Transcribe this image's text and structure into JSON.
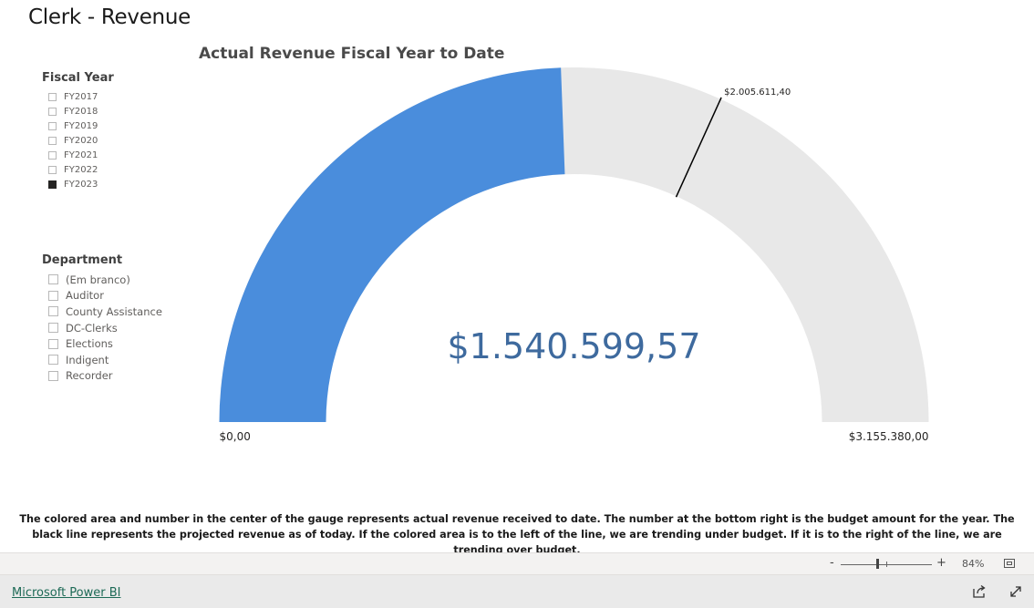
{
  "page": {
    "title": "Clerk - Revenue"
  },
  "slicers": {
    "fiscal_year": {
      "title": "Fiscal Year",
      "items": [
        {
          "label": "FY2017",
          "checked": false
        },
        {
          "label": "FY2018",
          "checked": false
        },
        {
          "label": "FY2019",
          "checked": false
        },
        {
          "label": "FY2020",
          "checked": false
        },
        {
          "label": "FY2021",
          "checked": false
        },
        {
          "label": "FY2022",
          "checked": false
        },
        {
          "label": "FY2023",
          "checked": true
        }
      ]
    },
    "department": {
      "title": "Department",
      "items": [
        {
          "label": "(Em branco)",
          "checked": false
        },
        {
          "label": "Auditor",
          "checked": false
        },
        {
          "label": "County Assistance",
          "checked": false
        },
        {
          "label": "DC-Clerks",
          "checked": false
        },
        {
          "label": "Elections",
          "checked": false
        },
        {
          "label": "Indigent",
          "checked": false
        },
        {
          "label": "Recorder",
          "checked": false
        }
      ]
    }
  },
  "chart_data": {
    "type": "gauge",
    "title": "Actual Revenue Fiscal Year to Date",
    "value": 1540599.57,
    "value_label": "$1.540.599,57",
    "min": 0,
    "min_label": "$0,00",
    "max": 3155380.0,
    "max_label": "$3.155.380,00",
    "target": 2005611.4,
    "target_label": "$2.005.611,40",
    "colors": {
      "fill": "#4a8ddc",
      "track": "#e8e8e8",
      "target": "#000000",
      "value_text": "#3e6a9e"
    }
  },
  "note": "The colored area and number in the center of the gauge represents actual revenue received to date.  The number at the bottom right is the budget amount for the year.  The black line represents the projected revenue as of today.  If the colored area is to the left of the line, we are trending under budget.  If it is to the right of the line, we are trending over budget.",
  "zoom": {
    "minus": "-",
    "plus": "+",
    "level": "84%"
  },
  "footer": {
    "link": "Microsoft Power BI"
  },
  "icons": {
    "fit": "fit-to-page-icon",
    "share": "share-icon",
    "expand": "expand-icon"
  }
}
